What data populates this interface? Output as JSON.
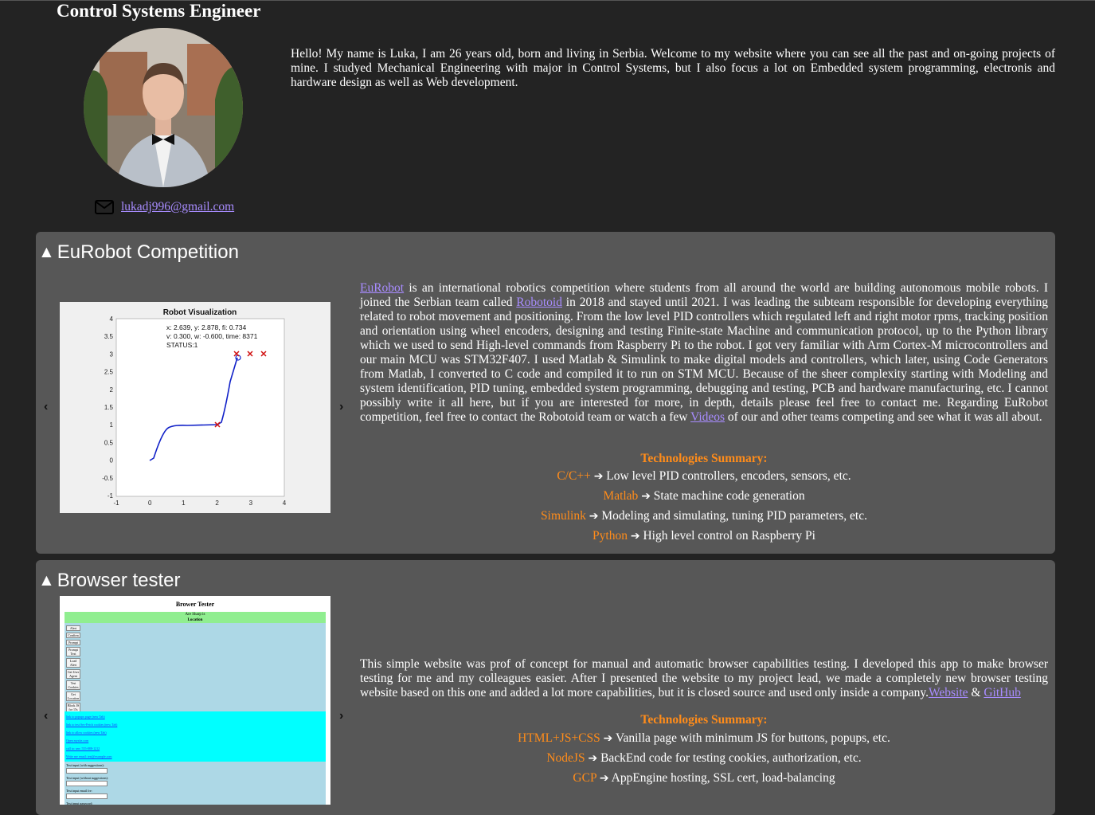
{
  "header": {
    "title": "Control Systems Engineer",
    "intro": "Hello! My name is Luka, I am 26 years old, born and living in Serbia. Welcome to my website where you can see all the past and on-going projects of mine. I studyed Mechanical Engineering with major in Control Systems, but I also focus a lot on Embedded system programming, electronis and hardware design as well as Web development.",
    "email": "lukadj996@gmail.com"
  },
  "projects": [
    {
      "title": "EuRobot Competition",
      "collapse_icon": "▲",
      "prev": "‹",
      "next": "›",
      "desc_link1": "EuRobot",
      "desc_p1": " is an international robotics competition where students from all around the world are building autonomous mobile robots. I joined the Serbian team called ",
      "desc_link2": "Robotoid",
      "desc_p2": " in 2018 and stayed until 2021. I was leading the subteam responsible for developing everything related to robot movement and positioning. From the low level PID controllers which regulated left and right motor rpms, tracking position and orientation using wheel encoders, designing and testing Finite-state Machine and communication protocol, up to the Python library which we used to send High-level commands from Raspberry Pi to the robot. I got very familiar with Arm Cortex-M microcontrollers and our main MCU was STM32F407. I used Matlab & Simulink to make digital models and controllers, which later, using Code Generators from Matlab, I converted to C code and compiled it to run on STM MCU. Because of the sheer complexity starting with Modeling and system identification, PID tuning, embedded system programming, debugging and testing, PCB and hardware manufacturing, etc. I cannot possibly write it all here, but if you are interested for more, in depth, details please feel free to contact me. Regarding EuRobot competition, feel free to contact the Robotoid team or watch a few ",
      "desc_link3": "Videos",
      "desc_p3": " of our and other teams competing and see what it was all about.",
      "tech_title": "Technologies Summary:",
      "tech": [
        {
          "name": "C/C++",
          "arrow": "➔",
          "desc": "Low level PID controllers, encoders, sensors, etc."
        },
        {
          "name": "Matlab",
          "arrow": "➔",
          "desc": "State machine code generation"
        },
        {
          "name": "Simulink",
          "arrow": "➔",
          "desc": "Modeling and simulating, tuning PID parameters, etc."
        },
        {
          "name": "Python",
          "arrow": "➔",
          "desc": "High level control on Raspberry Pi"
        }
      ],
      "figure": {
        "title": "Robot Visualization",
        "readout1": "x: 2.639, y: 2.878, fi: 0.734",
        "readout2": "v: 0.300, w: -0.600, time: 8371",
        "readout3": "STATUS:1",
        "xticks": [
          "-1",
          "0",
          "1",
          "2",
          "3",
          "4"
        ],
        "yticks": [
          "4",
          "3.5",
          "3",
          "2.5",
          "2",
          "1.5",
          "1",
          "0.5",
          "0",
          "-0.5",
          "-1"
        ]
      }
    },
    {
      "title": "Browser tester",
      "collapse_icon": "▲",
      "prev": "‹",
      "next": "›",
      "desc_p1": "This simple website was prof of concept for manual and automatic browser capabilities testing. I developed this app to make browser testing for me and my colleagues easier. After I presented the website to my project lead, we made a completely new browser testing website based on this one and added a lot more capabilities, but it is closed source and used only inside a company.",
      "desc_link1": "Website",
      "desc_amp": " & ",
      "desc_link2": "GitHub",
      "tech_title": "Technologies Summary:",
      "tech": [
        {
          "name": "HTML+JS+CSS",
          "arrow": "➔",
          "desc": "Vanilla page with minimum JS for buttons, popups, etc."
        },
        {
          "name": "NodeJS",
          "arrow": "➔",
          "desc": "BackEnd code for testing cookies, authorization, etc."
        },
        {
          "name": "GCP",
          "arrow": "➔",
          "desc": "AppEngine hosting, SSL cert, load-balancing"
        }
      ],
      "shot": {
        "title": "Brower Tester",
        "green1": "Are Sharp is",
        "green2": "Location",
        "buttons": [
          "Alert",
          "Confirm",
          "Prompt",
          "Prompt Text",
          "Load Alert",
          "Get User Agent",
          "Test Cookies",
          "Get Location",
          "Block JS for 15s"
        ],
        "links": [
          "link to popups page (new Tab)",
          "link to test Sec-Fetch cookies (new Tab)",
          "link to allow cookies (new Tab)",
          "Open mysite.com",
          "call to: sen: 555-888-1212",
          "Write me email: test@example.com"
        ],
        "fields": [
          "Text input (with suggestions):",
          "Text input (without suggestions):",
          "Text input email fre:",
          "Text input password:"
        ]
      }
    }
  ]
}
